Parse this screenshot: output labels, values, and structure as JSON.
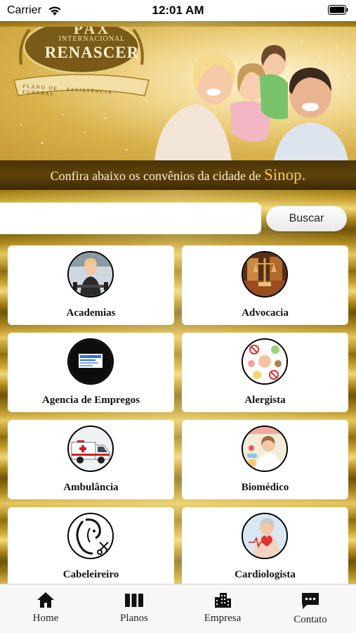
{
  "status_bar": {
    "carrier": "Carrier",
    "time": "12:01 AM"
  },
  "banner": {
    "logo_top": "PAX",
    "logo_sub": "INTERNACIONAL",
    "logo_name": "RENASCER",
    "logo_motto": "PLANO DE · ASSISTÊNCIA · FUNERAL",
    "subtitle": "Confira abaixo os convênios da cidade de ",
    "city": "Sinop."
  },
  "search": {
    "placeholder": "",
    "value": "",
    "button_label": "Buscar"
  },
  "categories": [
    {
      "label": "Academias",
      "icon": "gym-photo"
    },
    {
      "label": "Advocacia",
      "icon": "law-photo"
    },
    {
      "label": "Agencia de Empregos",
      "icon": "jobs-agency-logo"
    },
    {
      "label": "Alergista",
      "icon": "allergy-photo"
    },
    {
      "label": "Ambulância",
      "icon": "ambulance-photo"
    },
    {
      "label": "Biomédico",
      "icon": "biomedic-photo"
    },
    {
      "label": "Cabeleireiro",
      "icon": "hairdresser-photo"
    },
    {
      "label": "Cardiologista",
      "icon": "cardiology-photo"
    }
  ],
  "tab_bar": {
    "items": [
      {
        "label": "Home",
        "icon": "home-icon"
      },
      {
        "label": "Planos",
        "icon": "columns-icon"
      },
      {
        "label": "Empresa",
        "icon": "building-icon"
      },
      {
        "label": "Contato",
        "icon": "chat-icon"
      }
    ]
  },
  "colors": {
    "gold": "#c9a22e",
    "banner_bar": "#4a3305",
    "city": "#f2c955"
  }
}
